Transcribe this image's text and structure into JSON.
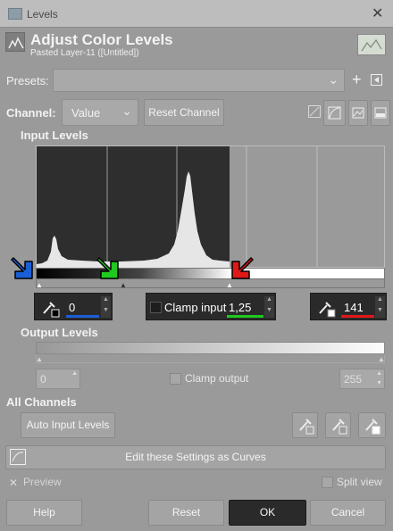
{
  "window": {
    "title": "Levels",
    "close_glyph": "✕"
  },
  "header": {
    "title": "Adjust Color Levels",
    "subtitle": "Pasted Layer-11 ([Untitled])"
  },
  "presets": {
    "label": "Presets:",
    "value": ""
  },
  "channel": {
    "label": "Channel:",
    "value": "Value",
    "reset_label": "Reset Channel"
  },
  "input_levels": {
    "title": "Input Levels",
    "low": "0",
    "gamma_label": "Clamp input",
    "gamma": "1,25",
    "high": "141"
  },
  "output_levels": {
    "title": "Output Levels",
    "low": "0",
    "clamp_label": "Clamp output",
    "high": "255"
  },
  "all_channels": {
    "title": "All Channels",
    "auto_label": "Auto Input Levels"
  },
  "curves_label": "Edit these Settings as Curves",
  "preview_label": "Preview",
  "split_label": "Split view",
  "buttons": {
    "help": "Help",
    "reset": "Reset",
    "ok": "OK",
    "cancel": "Cancel"
  },
  "colors": {
    "accent_blue": "#1a5fd6",
    "accent_green": "#1fc91f",
    "accent_red": "#e01818",
    "dark": "#2e2e2e"
  },
  "icons": [
    "levels-icon",
    "add-preset-icon",
    "menu-icon",
    "linear-hist-icon",
    "log-hist-icon",
    "picker-black-icon",
    "picker-gray-icon",
    "picker-white-icon",
    "curves-icon"
  ]
}
